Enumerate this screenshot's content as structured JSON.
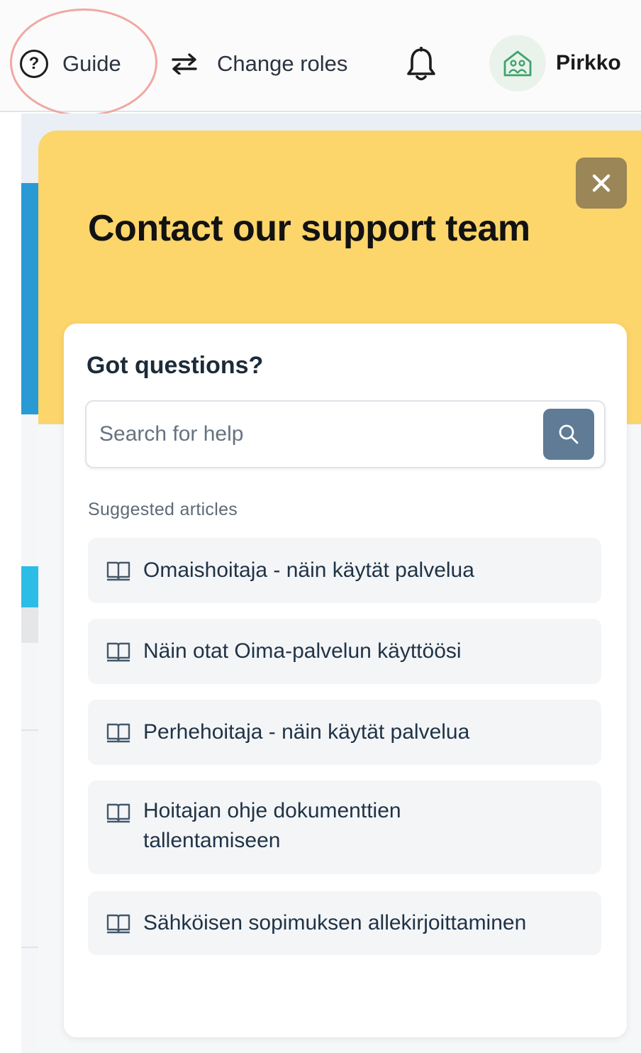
{
  "topbar": {
    "guide_label": "Guide",
    "change_roles_label": "Change roles",
    "user_name": "Pirkko"
  },
  "panel": {
    "title": "Contact our support team",
    "card_title": "Got questions?",
    "search": {
      "placeholder": "Search for help"
    },
    "suggested_label": "Suggested articles",
    "articles": [
      {
        "label": "Omaishoitaja - näin käytät palvelua"
      },
      {
        "label": "Näin otat Oima-palvelun käyttöösi"
      },
      {
        "label": "Perhehoitaja - näin käytät palvelua"
      },
      {
        "label": "Hoitajan ohje dokumenttien tallentamiseen"
      },
      {
        "label": "Sähköisen sopimuksen allekirjoittaminen"
      }
    ]
  },
  "colors": {
    "header_yellow": "#fcd56b",
    "close_button": "#9a8657",
    "search_button": "#5f7b95",
    "highlight_ring": "#f0a8a2",
    "avatar_green": "#3fa36b"
  },
  "icons": {
    "guide": "question-circle-icon",
    "change_roles": "swap-arrows-icon",
    "notifications": "bell-icon",
    "avatar": "house-people-icon",
    "close": "close-icon",
    "search": "search-icon",
    "article": "book-icon"
  }
}
